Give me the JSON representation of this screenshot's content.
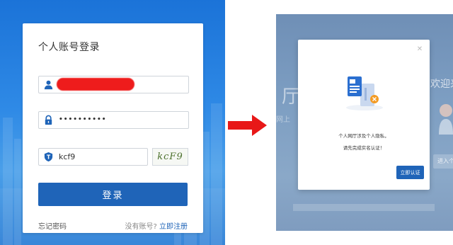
{
  "login": {
    "title": "个人账号登录",
    "username_value": "",
    "password_value": "••••••••••",
    "captcha_value": "kcf9",
    "captcha_image_text": "kcF9",
    "login_button": "登录",
    "forgot_password": "忘记密码",
    "no_account": "没有账号?",
    "register_link": "立即注册",
    "icons": {
      "user": "user-icon",
      "password": "lock-icon",
      "captcha": "shield-icon"
    },
    "colors": {
      "primary": "#1f64b8",
      "redaction": "#ee1c1c",
      "background": "#2f8ae6"
    }
  },
  "arrow": {
    "color": "#e81818",
    "icon": "right-arrow-icon"
  },
  "verify_screen": {
    "background_text": {
      "ting": "厅",
      "wang": "网上",
      "welcome": "欢迎来",
      "enter_button": "进入个"
    },
    "modal": {
      "message_line1": "个人网厅涉及个人隐私，",
      "message_line2": "请先完成实名认证！",
      "verify_button": "立即认证",
      "close_icon": "close-icon",
      "illustration_icon": "id-card-icon"
    }
  }
}
